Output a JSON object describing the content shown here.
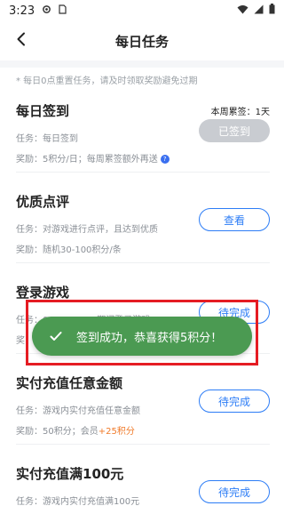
{
  "status_bar": {
    "time": "3:23",
    "icons": [
      "settings-icon",
      "sim-icon",
      "wifi-icon",
      "signal-icon",
      "battery-icon"
    ]
  },
  "header": {
    "title": "每日任务",
    "back_icon": "chevron-left-icon"
  },
  "notice": "* 每日0点重置任务，请及时领取奖励避免过期",
  "tasks": [
    {
      "title": "每日签到",
      "line1": "任务：每日签到",
      "line2": "奖励：5积分/日；每周累签额外再送",
      "week_count": "本周累签：1天",
      "button": "已签到",
      "button_state": "disabled"
    },
    {
      "title": "优质点评",
      "line1": "任务：对游戏进行点评，且达到优质",
      "line2": "奖励：随机30-100积分/条",
      "button": "查看",
      "button_state": "active"
    },
    {
      "title": "登录游戏",
      "line1": "任务：00:00-23:59期间登录游戏",
      "line2": "奖",
      "button": "待完成",
      "button_state": "active"
    },
    {
      "title": "实付充值任意金额",
      "line1": "任务：游戏内实付充值任意金额",
      "line2_prefix": "奖励：50积分；会员",
      "line2_plus": "+25积分",
      "button": "待完成",
      "button_state": "active"
    },
    {
      "title": "实付充值满100元",
      "line1": "任务：游戏内实付充值满100元",
      "button": "待完成",
      "button_state": "active"
    }
  ],
  "toast": {
    "message": "签到成功，恭喜获得5积分！",
    "icon": "check-icon"
  },
  "colors": {
    "accent": "#2d7df6",
    "toast_bg": "#4b9a52",
    "highlight_frame": "#e51c23",
    "plus_points": "#f07b2b",
    "disabled_button": "#c9ccd1"
  }
}
